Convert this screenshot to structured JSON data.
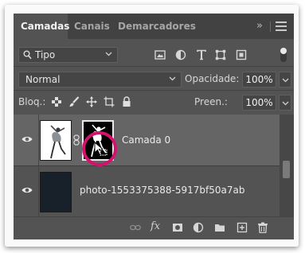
{
  "tabs": [
    {
      "label": "Camadas",
      "active": true
    },
    {
      "label": "Canais",
      "active": false
    },
    {
      "label": "Demarcadores",
      "active": false
    }
  ],
  "panel_menu_collapse": "»",
  "filter": {
    "kind_label": "Tipo"
  },
  "blend": {
    "mode": "Normal",
    "opacity_label": "Opacidade:",
    "opacity_value": "100%"
  },
  "lock": {
    "label": "Bloq.:",
    "fill_label": "Preen.:",
    "fill_value": "100%"
  },
  "layers": [
    {
      "name": "Camada 0",
      "selected": true,
      "has_mask": true
    },
    {
      "name": "photo-1553375388-5917bf50a7ab",
      "selected": false,
      "has_mask": false
    }
  ],
  "bottom_icons": [
    "link-icon",
    "fx-icon",
    "add-mask-icon",
    "adjustment-layer-icon",
    "group-folder-icon",
    "new-layer-icon",
    "trash-icon"
  ],
  "colors": {
    "panel": "#535353",
    "selected_row": "#656565",
    "highlight_ring": "#d3126d"
  }
}
